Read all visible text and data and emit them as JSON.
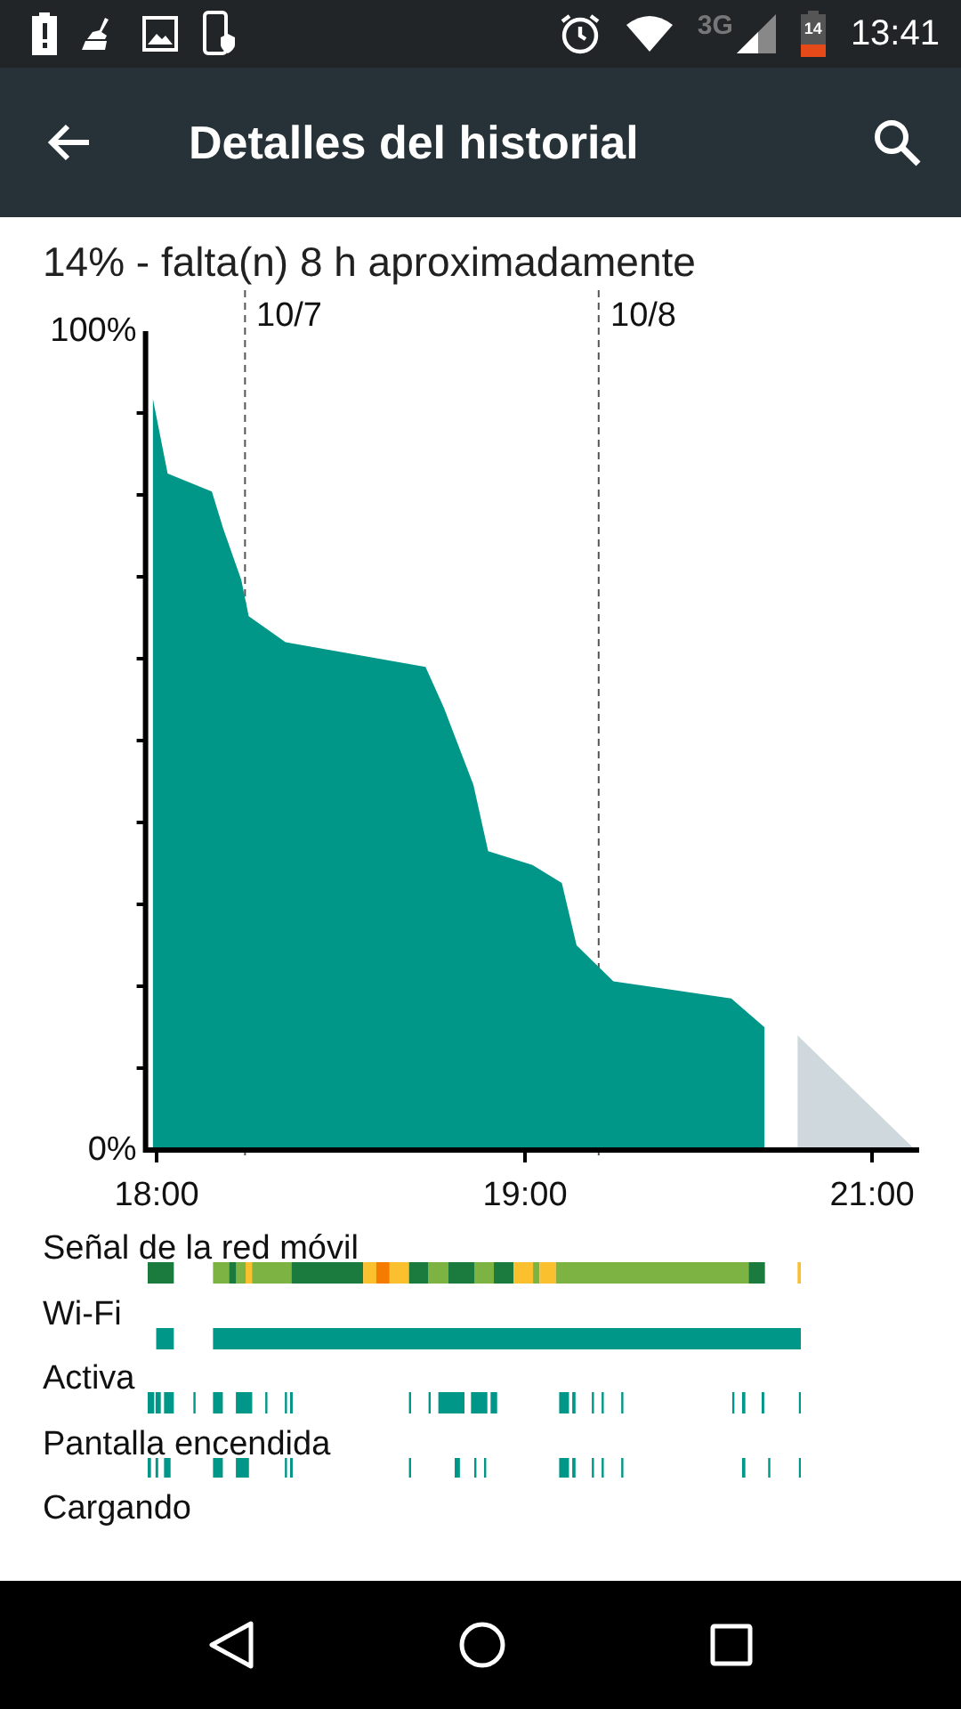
{
  "status_bar": {
    "network": "3G",
    "battery": "14",
    "time": "13:41"
  },
  "app_bar": {
    "title": "Detalles del historial"
  },
  "summary": "14% - falta(n) 8 h aproximadamente",
  "chart": {
    "date_markers": [
      "10/7",
      "10/8"
    ],
    "end_time_label": "21:00",
    "chart_data": {
      "type": "area",
      "xlim": [
        17.97,
        20.07
      ],
      "ylim": [
        0,
        100
      ],
      "x": [
        17.99,
        18.03,
        18.15,
        18.18,
        18.23,
        18.25,
        18.35,
        18.73,
        18.78,
        18.86,
        18.9,
        19.02,
        19.1,
        19.14,
        19.24,
        19.56,
        19.65,
        19.74,
        20.06
      ],
      "series": [
        {
          "color": "#009688",
          "values": [
            91.7,
            82.6,
            80.4,
            76,
            69.6,
            65.2,
            62,
            59,
            54,
            44.6,
            36.5,
            34.8,
            32.6,
            25,
            20.6,
            18.5,
            15,
            null,
            null
          ]
        },
        {
          "color": "#cfd8dc",
          "values": [
            null,
            null,
            null,
            null,
            null,
            null,
            null,
            null,
            null,
            null,
            null,
            null,
            null,
            null,
            null,
            null,
            null,
            14,
            0
          ]
        }
      ],
      "xticks": [
        {
          "value": 18,
          "label": "18:00"
        },
        {
          "value": 19,
          "label": "19:00"
        }
      ],
      "yticks": [
        {
          "value": 0,
          "label": "0%"
        },
        {
          "value": 100,
          "label": "100%"
        }
      ],
      "ref_lines": [
        {
          "axis": "x",
          "value": 18.24
        },
        {
          "axis": "x",
          "value": 19.2
        }
      ]
    }
  },
  "tracks": [
    {
      "label": "Señal de la red móvil",
      "kind": "signal"
    },
    {
      "label": "Wi-Fi",
      "kind": "wifi"
    },
    {
      "label": "Activa",
      "kind": "active"
    },
    {
      "label": "Pantalla encendida",
      "kind": "screen"
    },
    {
      "label": "Cargando",
      "kind": "charging"
    }
  ]
}
